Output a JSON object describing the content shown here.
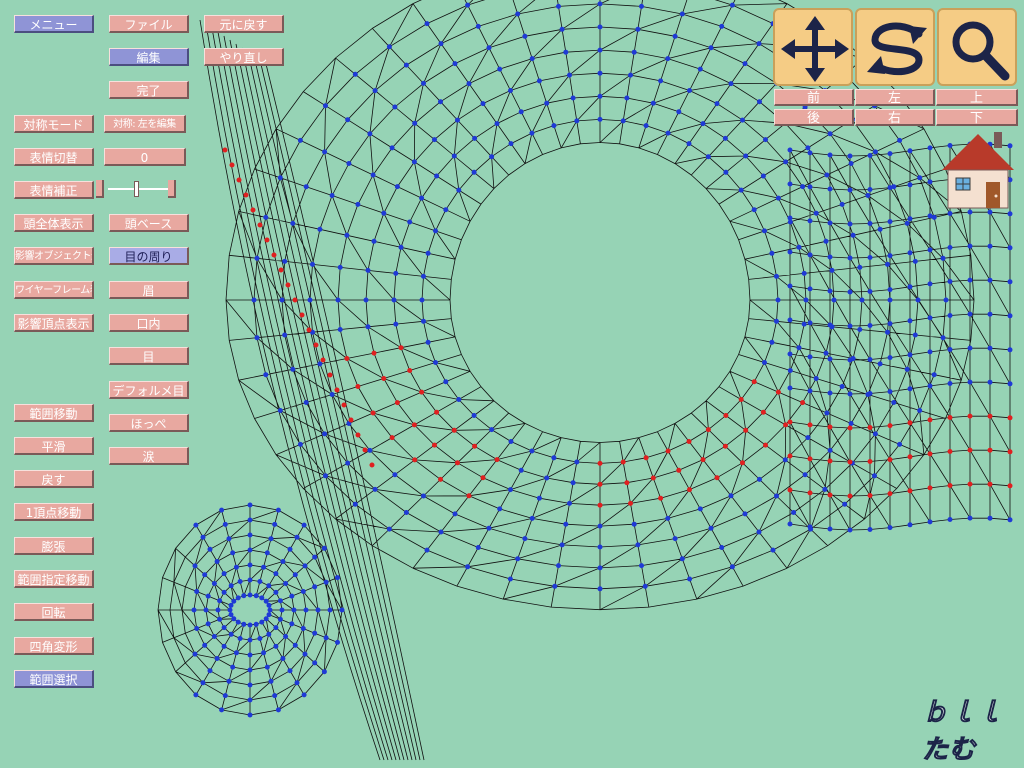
{
  "left_column": {
    "menu": "メニュー",
    "symmetry_mode": "対称モード",
    "expression_switch": "表情切替",
    "expression_correction": "表情補正",
    "show_whole_head": "頭全体表示",
    "select_affected_objects": "影響オブジェクト選択",
    "show_wireframe": "ワイヤーフレーム表示",
    "show_affected_vertices": "影響頂点表示",
    "range_move": "範囲移動",
    "smooth": "平滑",
    "revert": "戻す",
    "move_one_vertex": "1頂点移動",
    "inflate": "膨張",
    "range_specified_move": "範囲指定移動",
    "rotate": "回転",
    "quad_transform": "四角変形",
    "range_select": "範囲選択"
  },
  "mid_column": {
    "file": "ファイル",
    "edit": "編集",
    "done": "完了",
    "symmetry_value": "対称: 左を編集",
    "expression_value": "0",
    "head_base": "頭ベース",
    "around_eyes": "目の周り",
    "eyebrow": "眉",
    "inside_mouth": "口内",
    "eye": "目",
    "deformed_eye": "デフォルメ目",
    "cheek": "ほっぺ",
    "tears": "涙"
  },
  "history": {
    "undo": "元に戻す",
    "redo": "やり直し"
  },
  "nav": {
    "front": "前",
    "left": "左",
    "up": "上",
    "back": "後",
    "right": "右",
    "down": "下"
  },
  "tools": {
    "move": "move-arrows-icon",
    "rotate": "rotate-icon",
    "zoom": "magnifier-icon"
  },
  "logo_text": "ｂｌｌたむ",
  "colors": {
    "background": "#96d3b5",
    "button": "#e8a8a0",
    "button_selected": "#8f94d6",
    "vertex_blue": "#1f3ad6",
    "vertex_red": "#e02020",
    "tool_bg": "#f5cc85"
  }
}
